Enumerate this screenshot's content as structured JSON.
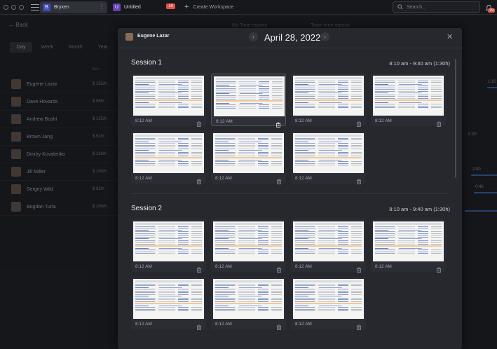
{
  "topbar": {
    "workspaces": [
      {
        "name": "Bryxen",
        "logo_letter": "B"
      },
      {
        "name": "Untitled",
        "logo_letter": "U",
        "badge": "10"
      }
    ],
    "create_workspace": "Create Workspace",
    "search_placeholder": "Search...",
    "notification_badge": "99"
  },
  "background": {
    "back_label": "Back",
    "tabs": [
      "My Time reports",
      "Team time reports"
    ],
    "periods": [
      "Day",
      "Week",
      "Month",
      "Year"
    ],
    "active_period": "Day",
    "rate_header": "Rate",
    "users": [
      {
        "name": "Eugene Lazar",
        "rate": "$ 155/h"
      },
      {
        "name": "Dave Hovards",
        "rate": "$ 95/h"
      },
      {
        "name": "Andrew Bushi",
        "rate": "$ 125/h"
      },
      {
        "name": "Brown Jang",
        "rate": "$ 91/h"
      },
      {
        "name": "Dmitry Kovalenko",
        "rate": "$ 118/h"
      },
      {
        "name": "Jill Miller",
        "rate": "$ 100/h"
      },
      {
        "name": "Sergey Wild",
        "rate": "$ 82/h"
      },
      {
        "name": "Bogdan Turla",
        "rate": "$ 100/h"
      }
    ],
    "timeline_labels": [
      "1:10",
      "0:20",
      "2:00",
      "0:40"
    ]
  },
  "modal": {
    "user": "Eugene Lazar",
    "date": "April 28, 2022",
    "sessions": [
      {
        "title": "Session 1",
        "range": "8:10 am - 9:40 am (1:30h)",
        "screenshots": [
          "8:12 AM",
          "8:12 AM",
          "8:12 AM",
          "8:12 AM",
          "8:12 AM",
          "8:12 AM",
          "8:12 AM"
        ]
      },
      {
        "title": "Session 2",
        "range": "8:10 am - 9:40 am (1:30h)",
        "screenshots": [
          "8:12 AM",
          "8:12 AM",
          "8:12 AM",
          "8:12 AM",
          "8:12 AM",
          "8:12 AM",
          "8:12 AM"
        ]
      }
    ]
  },
  "colors": {
    "accent": "#3e4bb8",
    "badge": "#e3514c",
    "timeline_bar": "#3f6fb8"
  }
}
